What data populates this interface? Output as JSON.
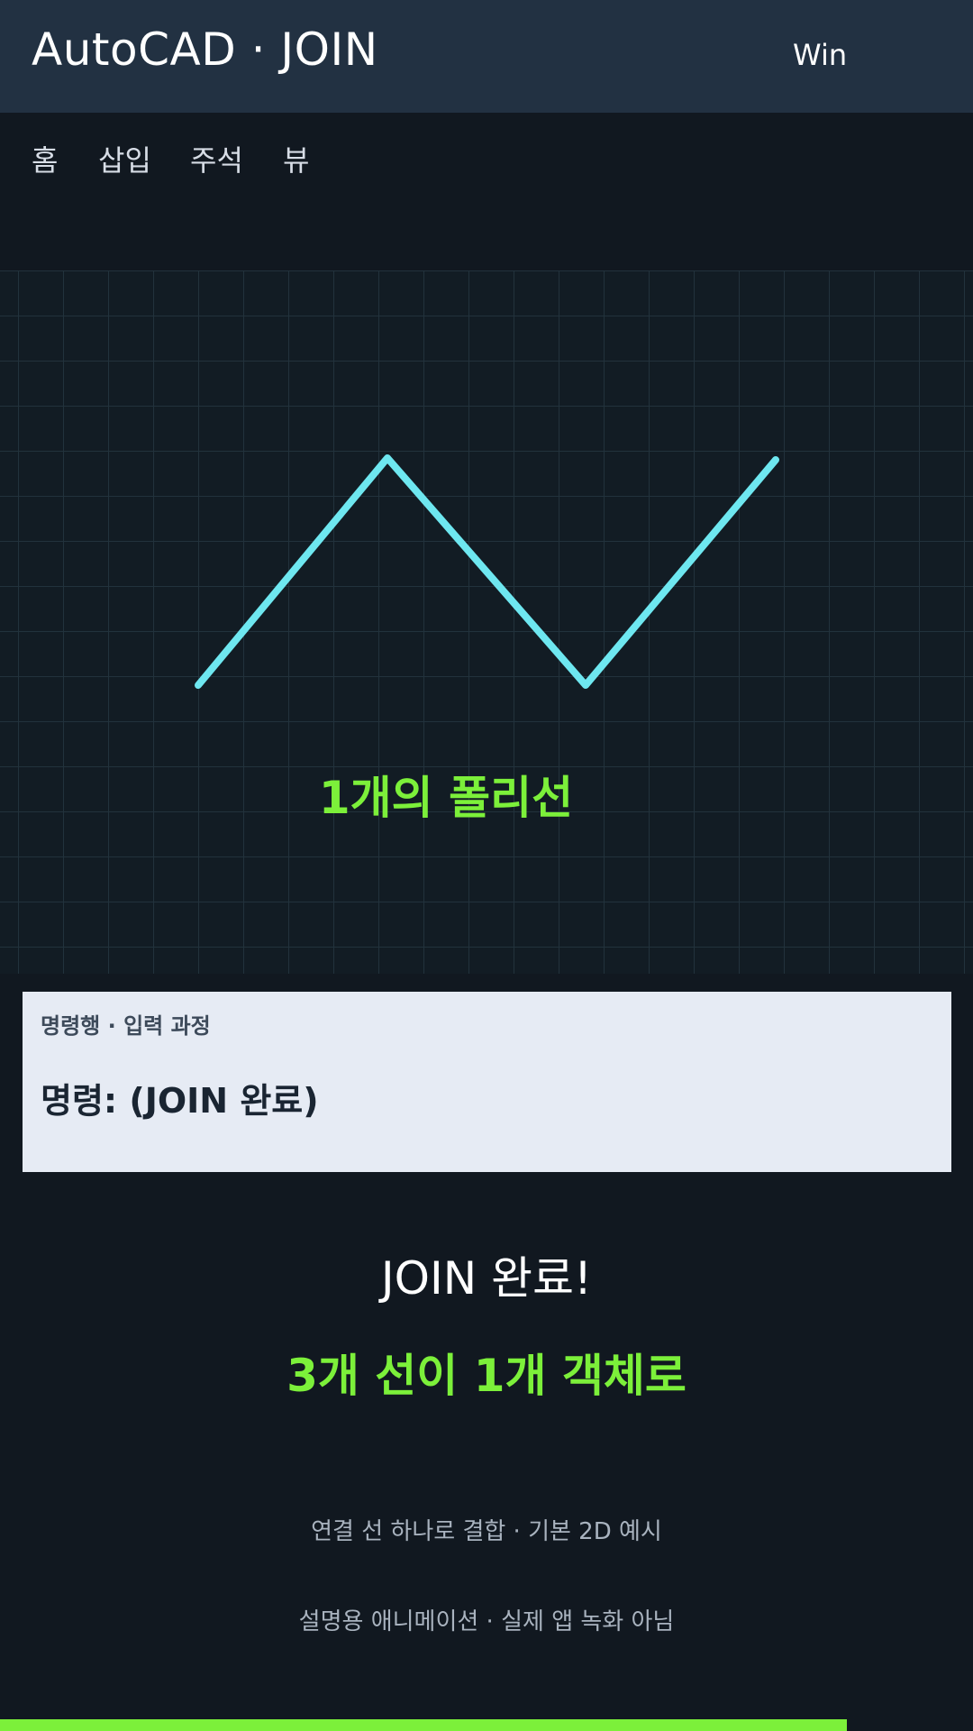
{
  "header": {
    "title": "AutoCAD · JOIN",
    "platform": "Win"
  },
  "ribbon": {
    "tabs": [
      {
        "label": "홈"
      },
      {
        "label": "삽입"
      },
      {
        "label": "주석"
      },
      {
        "label": "뷰"
      }
    ]
  },
  "canvas": {
    "label": "1개의 폴리선",
    "polyline_color": "#6ee7f0",
    "grid_color": "#22323c"
  },
  "command_panel": {
    "caption": "명령행 · 입력 과정",
    "line": "명령: (JOIN 완료)"
  },
  "result": {
    "title": "JOIN 완료!",
    "subtitle": "3개 선이 1개 객체로"
  },
  "notes": {
    "line1": "연결 선 하나로 결합 · 기본 2D 예시",
    "line2": "설명용 애니메이션 · 실제 앱 녹화 아님"
  },
  "progress": {
    "fraction": 0.87,
    "color": "#7cf03a"
  }
}
